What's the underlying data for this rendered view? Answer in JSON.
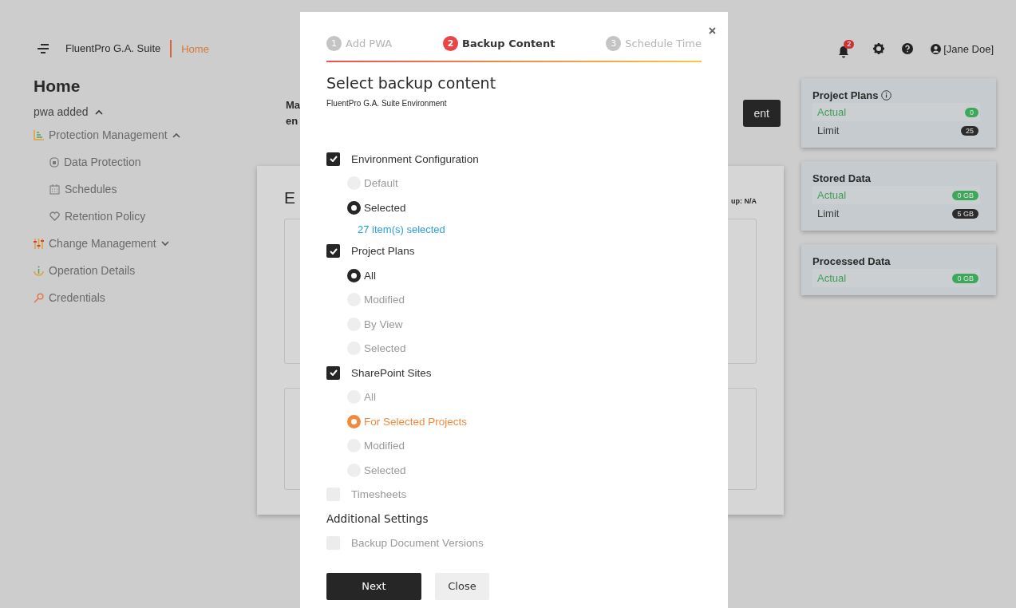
{
  "header": {
    "app_name": "FluentPro G.A. Suite",
    "breadcrumb": "Home",
    "notification_count": "2",
    "user": "[Jane Doe]"
  },
  "sidebar": {
    "title": "Home",
    "group": {
      "label": "pwa added",
      "expanded": true
    },
    "items": [
      {
        "label": "Protection Management",
        "expanded": true,
        "children": [
          {
            "label": "Data Protection"
          },
          {
            "label": "Schedules"
          },
          {
            "label": "Retention Policy"
          }
        ]
      },
      {
        "label": "Change Management",
        "expanded": false
      },
      {
        "label": "Operation Details"
      },
      {
        "label": "Credentials"
      }
    ]
  },
  "main": {
    "intro_line_1": "Ma",
    "intro_line_2": "en",
    "action_button": "ent",
    "card_title": "E",
    "card_status": "up: N/A"
  },
  "stats": [
    {
      "title": "Project Plans",
      "info": true,
      "rows": [
        {
          "label": "Actual",
          "value": "0",
          "kind": "actual"
        },
        {
          "label": "Limit",
          "value": "25",
          "kind": "limit"
        }
      ]
    },
    {
      "title": "Stored Data",
      "info": false,
      "rows": [
        {
          "label": "Actual",
          "value": "0 GB",
          "kind": "actual"
        },
        {
          "label": "Limit",
          "value": "5 GB",
          "kind": "limit"
        }
      ]
    },
    {
      "title": "Processed Data",
      "info": false,
      "rows": [
        {
          "label": "Actual",
          "value": "0 GB",
          "kind": "actual"
        }
      ]
    }
  ],
  "modal": {
    "steps": [
      {
        "number": "1",
        "label": "Add PWA",
        "selected": false
      },
      {
        "number": "2",
        "label": "Backup Content",
        "selected": true
      },
      {
        "number": "3",
        "label": "Schedule Time",
        "selected": false
      }
    ],
    "title": "Select backup content",
    "subtitle": "FluentPro G.A. Suite Environment",
    "sections": [
      {
        "label": "Environment Configuration",
        "checked": true,
        "options": [
          {
            "label": "Default",
            "selected": false,
            "focused": false
          },
          {
            "label": "Selected",
            "selected": true,
            "focused": false
          }
        ],
        "note": "27 item(s) selected"
      },
      {
        "label": "Project Plans",
        "checked": true,
        "options": [
          {
            "label": "All",
            "selected": true,
            "focused": false
          },
          {
            "label": "Modified",
            "selected": false,
            "focused": false
          },
          {
            "label": "By View",
            "selected": false,
            "focused": false
          },
          {
            "label": "Selected",
            "selected": false,
            "focused": false
          }
        ]
      },
      {
        "label": "SharePoint Sites",
        "checked": true,
        "options": [
          {
            "label": "All",
            "selected": false,
            "focused": false
          },
          {
            "label": "For Selected Projects",
            "selected": true,
            "focused": true
          },
          {
            "label": "Modified",
            "selected": false,
            "focused": false
          },
          {
            "label": "Selected",
            "selected": false,
            "focused": false
          }
        ]
      },
      {
        "label": "Timesheets",
        "checked": false
      }
    ],
    "additional_title": "Additional Settings",
    "additional": [
      {
        "label": "Backup Document Versions",
        "checked": false
      }
    ],
    "buttons": [
      {
        "label": "Next",
        "kind": "primary"
      },
      {
        "label": "Close",
        "kind": "secondary"
      }
    ]
  }
}
